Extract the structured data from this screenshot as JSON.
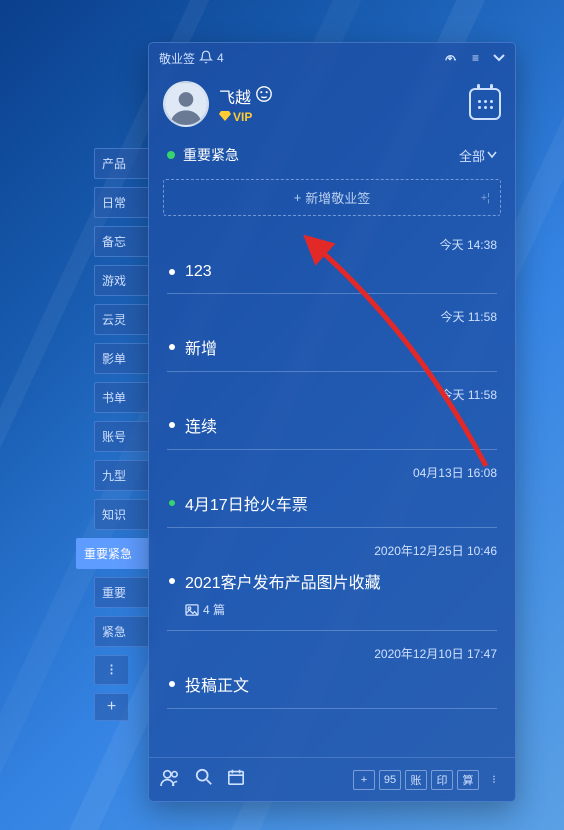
{
  "app_name": "敬业签",
  "notification_count": "4",
  "user": {
    "name": "飞越",
    "vip_label": "VIP"
  },
  "category": {
    "name": "重要紧急",
    "filter_label": "全部"
  },
  "new_note_button": "新增敬业签",
  "side_tabs": [
    {
      "label": "产品",
      "key": "product"
    },
    {
      "label": "日常",
      "key": "daily"
    },
    {
      "label": "备忘",
      "key": "memo"
    },
    {
      "label": "游戏",
      "key": "game"
    },
    {
      "label": "云灵",
      "key": "yunling"
    },
    {
      "label": "影单",
      "key": "movie"
    },
    {
      "label": "书单",
      "key": "book"
    },
    {
      "label": "账号",
      "key": "account"
    },
    {
      "label": "九型",
      "key": "nine"
    },
    {
      "label": "知识",
      "key": "knowledge"
    },
    {
      "label": "重要紧急",
      "key": "urgent",
      "active": true
    },
    {
      "label": "重要",
      "key": "important"
    },
    {
      "label": "紧急",
      "key": "urgent2"
    }
  ],
  "side_icon_tabs": [
    "⁝",
    "+"
  ],
  "notes": [
    {
      "time": "今天 14:38",
      "title": "123",
      "dot": "white"
    },
    {
      "time": "今天 11:58",
      "title": "新增",
      "dot": "white"
    },
    {
      "time": "今天 11:58",
      "title": "连续",
      "dot": "white"
    },
    {
      "time": "04月13日 16:08",
      "title": "4月17日抢火车票",
      "dot": "green"
    },
    {
      "time": "2020年12月25日 10:46",
      "title": "2021客户发布产品图片收藏",
      "dot": "white",
      "images": "4 篇"
    },
    {
      "time": "2020年12月10日 17:47",
      "title": "投稿正文",
      "dot": "white"
    }
  ],
  "bottom_bar_buttons": [
    "+",
    "95",
    "账",
    "印",
    "算"
  ]
}
